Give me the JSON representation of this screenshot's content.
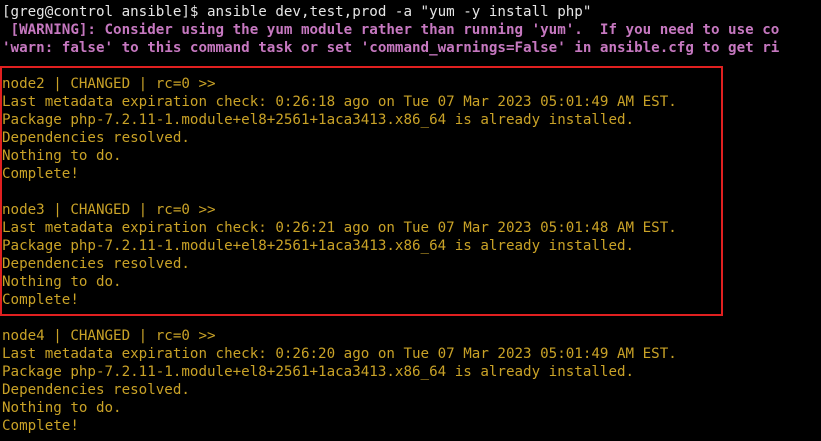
{
  "terminal": {
    "prompt_line": "[greg@control ansible]$ ansible dev,test,prod -a \"yum -y install php\"",
    "warning_line1": " [WARNING]: Consider using the yum module rather than running 'yum'.  If you need to use co",
    "warning_line2": "'warn: false' to this command task or set 'command_warnings=False' in ansible.cfg to get ri",
    "colors": {
      "background": "#000000",
      "prompt": "#e6e6e6",
      "warning": "#c678c0",
      "output": "#c9a227",
      "highlight_border": "#e02020"
    },
    "blocks": [
      {
        "header": "node2 | CHANGED | rc=0 >>",
        "lines": [
          "Last metadata expiration check: 0:26:18 ago on Tue 07 Mar 2023 05:01:49 AM EST.",
          "Package php-7.2.11-1.module+el8+2561+1aca3413.x86_64 is already installed.",
          "Dependencies resolved.",
          "Nothing to do.",
          "Complete!"
        ]
      },
      {
        "header": "node3 | CHANGED | rc=0 >>",
        "lines": [
          "Last metadata expiration check: 0:26:21 ago on Tue 07 Mar 2023 05:01:48 AM EST.",
          "Package php-7.2.11-1.module+el8+2561+1aca3413.x86_64 is already installed.",
          "Dependencies resolved.",
          "Nothing to do.",
          "Complete!"
        ]
      },
      {
        "header": "node4 | CHANGED | rc=0 >>",
        "lines": [
          "Last metadata expiration check: 0:26:20 ago on Tue 07 Mar 2023 05:01:49 AM EST.",
          "Package php-7.2.11-1.module+el8+2561+1aca3413.x86_64 is already installed.",
          "Dependencies resolved.",
          "Nothing to do.",
          "Complete!"
        ]
      }
    ]
  }
}
